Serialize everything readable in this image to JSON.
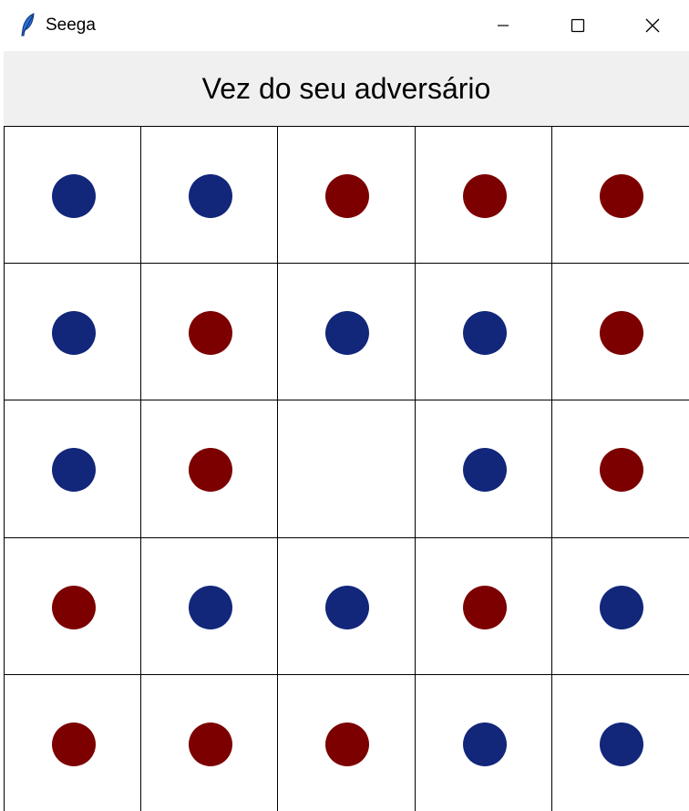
{
  "window": {
    "title": "Seega",
    "app_icon": "feather-icon",
    "controls": [
      "minimize-icon",
      "maximize-icon",
      "close-icon"
    ]
  },
  "status": {
    "text": "Vez do seu adversário"
  },
  "colors": {
    "blue_piece": "#12267a",
    "red_piece": "#7c0000",
    "grid_line": "#000000",
    "status_background": "#f0f0f0"
  },
  "board": {
    "rows": 5,
    "cols": 5,
    "cells": [
      [
        "blue",
        "blue",
        "red",
        "red",
        "red"
      ],
      [
        "blue",
        "red",
        "blue",
        "blue",
        "red"
      ],
      [
        "blue",
        "red",
        "empty",
        "blue",
        "red"
      ],
      [
        "red",
        "blue",
        "blue",
        "red",
        "blue"
      ],
      [
        "red",
        "red",
        "red",
        "blue",
        "blue"
      ]
    ]
  }
}
